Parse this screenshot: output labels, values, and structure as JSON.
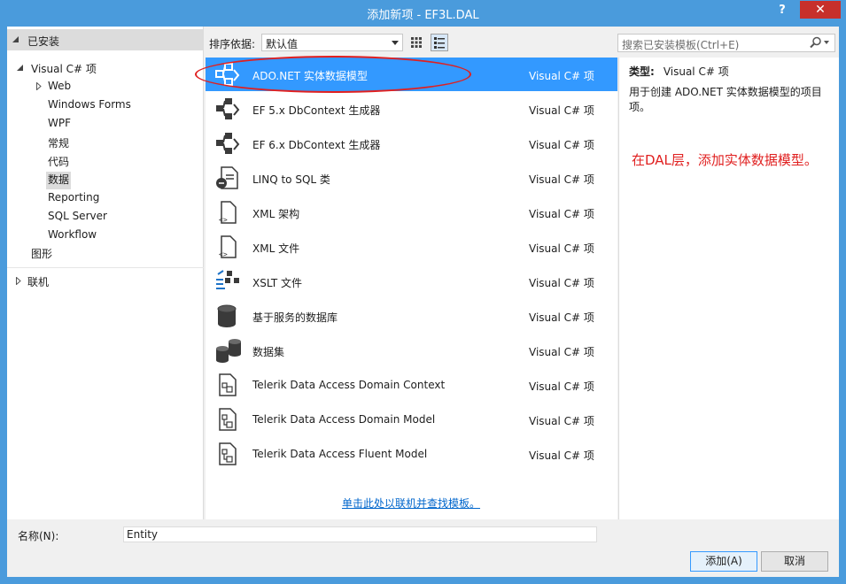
{
  "window": {
    "title": "添加新项 - EF3L.DAL",
    "help": "?",
    "close": "✕"
  },
  "left": {
    "installed": "已安装",
    "tree": [
      {
        "label": "Visual C# 项"
      },
      {
        "label": "Web"
      },
      {
        "label": "Windows Forms"
      },
      {
        "label": "WPF"
      },
      {
        "label": "常规"
      },
      {
        "label": "代码"
      },
      {
        "label": "数据"
      },
      {
        "label": "Reporting"
      },
      {
        "label": "SQL Server"
      },
      {
        "label": "Workflow"
      },
      {
        "label": "图形"
      }
    ],
    "online": "联机"
  },
  "toolbar": {
    "sort_label": "排序依据:",
    "sort_value": "默认值",
    "search_placeholder": "搜索已安装模板(Ctrl+E)"
  },
  "items": [
    {
      "name": "ADO.NET 实体数据模型",
      "kind": "Visual C# 项",
      "icon": "ado-entity-icon"
    },
    {
      "name": "EF 5.x DbContext 生成器",
      "kind": "Visual C# 项",
      "icon": "ef-generator-icon"
    },
    {
      "name": "EF 6.x DbContext 生成器",
      "kind": "Visual C# 项",
      "icon": "ef-generator-icon"
    },
    {
      "name": "LINQ to SQL 类",
      "kind": "Visual C# 项",
      "icon": "linq-icon"
    },
    {
      "name": "XML 架构",
      "kind": "Visual C# 项",
      "icon": "xml-schema-icon"
    },
    {
      "name": "XML 文件",
      "kind": "Visual C# 项",
      "icon": "xml-file-icon"
    },
    {
      "name": "XSLT 文件",
      "kind": "Visual C# 项",
      "icon": "xslt-icon"
    },
    {
      "name": "基于服务的数据库",
      "kind": "Visual C# 项",
      "icon": "database-icon"
    },
    {
      "name": "数据集",
      "kind": "Visual C# 项",
      "icon": "dataset-icon"
    },
    {
      "name": "Telerik Data Access Domain Context",
      "kind": "Visual C# 项",
      "icon": "telerik-context-icon"
    },
    {
      "name": "Telerik Data Access Domain Model",
      "kind": "Visual C# 项",
      "icon": "telerik-model-icon"
    },
    {
      "name": "Telerik Data Access Fluent Model",
      "kind": "Visual C# 项",
      "icon": "telerik-fluent-icon"
    }
  ],
  "online_link": "单击此处以联机并查找模板。",
  "details": {
    "type_label": "类型:",
    "type_value": "Visual C# 项",
    "description": "用于创建 ADO.NET 实体数据模型的项目项。",
    "annotation": "在DAL层，添加实体数据模型。"
  },
  "bottom": {
    "name_label": "名称(N):",
    "name_value": "Entity",
    "add_button": "添加(A)",
    "cancel_button": "取消"
  },
  "colors": {
    "accent": "#3399ff",
    "titlebar": "#4a9bdc",
    "close": "#c7302b",
    "annotation": "#e02020"
  }
}
